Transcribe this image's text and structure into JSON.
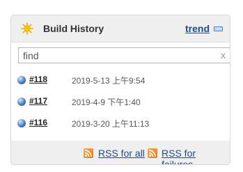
{
  "header": {
    "title": "Build History",
    "trend_label": "trend"
  },
  "search": {
    "placeholder": "find",
    "clear_label": "x"
  },
  "builds": [
    {
      "number": "#118",
      "date": "2019-5-13 上午9:54"
    },
    {
      "number": "#117",
      "date": "2019-4-9 下午1:40"
    },
    {
      "number": "#116",
      "date": "2019-3-20 上午11:13"
    }
  ],
  "footer": {
    "rss_all_label": "RSS for all",
    "rss_failures_label": "RSS for failures"
  },
  "icons": {
    "header": "sun-icon",
    "trend": "trend-graph-icon",
    "build_status": "blue-ball-icon",
    "rss": "rss-feed-icon"
  },
  "colors": {
    "link": "#204a87",
    "rss": "#e8731a",
    "status_ball": "#2b5ca8",
    "sun": "#f5c400"
  }
}
